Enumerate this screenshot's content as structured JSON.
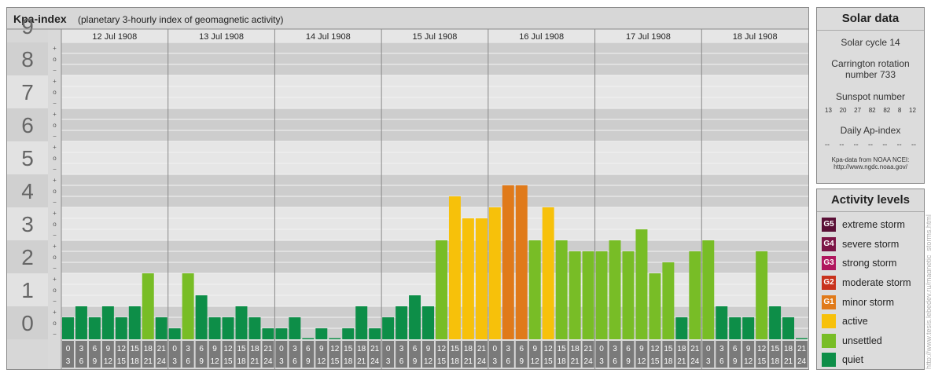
{
  "chart_data": {
    "type": "bar",
    "title": "Kpa-index",
    "subtitle": "(planetary 3-hourly index of geomagnetic activity)",
    "ylim": [
      0,
      9
    ],
    "y_ticks": [
      "0",
      "1",
      "2",
      "3",
      "4",
      "5",
      "6",
      "7",
      "8",
      "9"
    ],
    "minor_ticks": [
      "−",
      "o",
      "+"
    ],
    "days": [
      "12 Jul 1908",
      "13 Jul 1908",
      "14 Jul 1908",
      "15 Jul 1908",
      "16 Jul 1908",
      "17 Jul 1908",
      "18 Jul 1908"
    ],
    "slot_labels": [
      [
        "0",
        "3"
      ],
      [
        "3",
        "6"
      ],
      [
        "6",
        "9"
      ],
      [
        "9",
        "12"
      ],
      [
        "12",
        "15"
      ],
      [
        "15",
        "18"
      ],
      [
        "18",
        "21"
      ],
      [
        "21",
        "24"
      ]
    ],
    "values": [
      [
        0.667,
        1.0,
        0.667,
        1.0,
        0.667,
        1.0,
        2.0,
        0.667
      ],
      [
        0.333,
        2.0,
        1.333,
        0.667,
        0.667,
        1.0,
        0.667,
        0.333
      ],
      [
        0.333,
        0.667,
        0.0,
        0.333,
        0.0,
        0.333,
        1.0,
        0.333
      ],
      [
        0.667,
        1.0,
        1.333,
        1.0,
        3.0,
        4.333,
        3.667,
        3.667
      ],
      [
        4.0,
        4.667,
        4.667,
        3.0,
        4.0,
        3.0,
        2.667,
        2.667
      ],
      [
        2.667,
        3.0,
        2.667,
        3.333,
        2.0,
        2.333,
        0.667,
        2.667
      ],
      [
        3.0,
        1.0,
        0.667,
        0.667,
        2.667,
        1.0,
        0.667,
        0.0
      ]
    ],
    "grid": true
  },
  "solar": {
    "title": "Solar data",
    "cycle": "Solar cycle 14",
    "carrington_line1": "Carrington rotation",
    "carrington_line2": "number 733",
    "sunspot_title": "Sunspot number",
    "sunspots": [
      "13",
      "20",
      "27",
      "82",
      "82",
      "8",
      "12"
    ],
    "ap_title": "Daily Ap-index",
    "ap_values": [
      "--",
      "--",
      "--",
      "--",
      "--",
      "--",
      "--"
    ],
    "source_line1": "Kpa-data from NOAA NCEI:",
    "source_line2": "http://www.ngdc.noaa.gov/"
  },
  "activity": {
    "title": "Activity levels",
    "levels": [
      {
        "badge": "G5",
        "label": "extreme storm",
        "color": "#5a0f36"
      },
      {
        "badge": "G4",
        "label": "severe storm",
        "color": "#7c1446"
      },
      {
        "badge": "G3",
        "label": "strong storm",
        "color": "#b0175e"
      },
      {
        "badge": "G2",
        "label": "moderate storm",
        "color": "#c8321c"
      },
      {
        "badge": "G1",
        "label": "minor storm",
        "color": "#e07a1a"
      },
      {
        "badge": "",
        "label": "active",
        "color": "#f7c10a"
      },
      {
        "badge": "",
        "label": "unsettled",
        "color": "#78bd26"
      },
      {
        "badge": "",
        "label": "quiet",
        "color": "#0d8e48"
      }
    ]
  },
  "credit": "http://www.tesis.lebedev.ru/magnetic_storms.html"
}
